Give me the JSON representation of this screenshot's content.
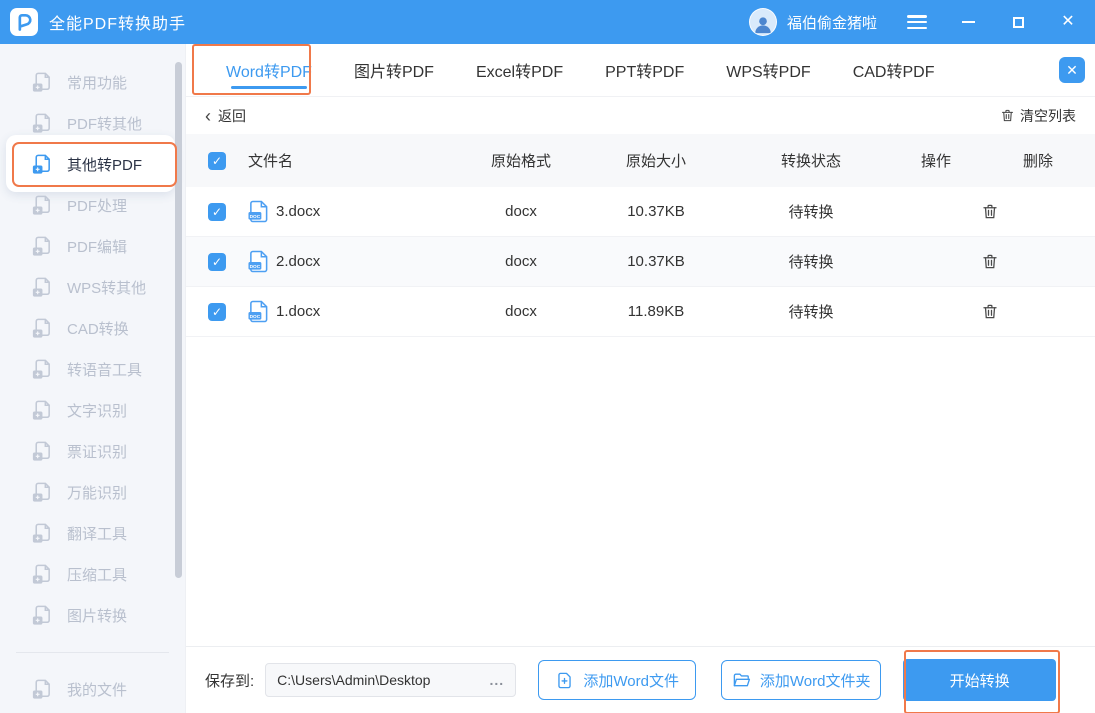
{
  "colors": {
    "accent": "#3D9AF0",
    "annotation_orange": "#F0794A",
    "topbar_blue": "#3D9AF0"
  },
  "titlebar": {
    "title": "全能PDF转换助手",
    "username": "福伯偷金猪啦",
    "controls": {
      "minimize": "─",
      "maximize": "□",
      "close": "✕"
    }
  },
  "sidebar": {
    "items": [
      {
        "label": "常用功能"
      },
      {
        "label": "PDF转其他"
      },
      {
        "label": "其他转PDF"
      },
      {
        "label": "PDF处理"
      },
      {
        "label": "PDF编辑"
      },
      {
        "label": "WPS转其他"
      },
      {
        "label": "CAD转换"
      },
      {
        "label": "转语音工具"
      },
      {
        "label": "文字识别"
      },
      {
        "label": "票证识别"
      },
      {
        "label": "万能识别"
      },
      {
        "label": "翻译工具"
      },
      {
        "label": "压缩工具"
      },
      {
        "label": "图片转换"
      },
      {
        "label": "我的文件"
      }
    ],
    "active_index": 2
  },
  "tabs": {
    "items": [
      {
        "label": "Word转PDF"
      },
      {
        "label": "图片转PDF"
      },
      {
        "label": "Excel转PDF"
      },
      {
        "label": "PPT转PDF"
      },
      {
        "label": "WPS转PDF"
      },
      {
        "label": "CAD转PDF"
      }
    ],
    "active_index": 0,
    "close": "✕"
  },
  "toolbar": {
    "back_chevron": "‹",
    "back": "返回",
    "clear": "清空列表"
  },
  "table": {
    "columns": [
      "文件名",
      "原始格式",
      "原始大小",
      "转换状态",
      "操作",
      "删除"
    ],
    "rows": [
      {
        "name": "3.docx",
        "format": "docx",
        "size": "10.37KB",
        "status": "待转换",
        "checked": true
      },
      {
        "name": "2.docx",
        "format": "docx",
        "size": "10.37KB",
        "status": "待转换",
        "checked": true
      },
      {
        "name": "1.docx",
        "format": "docx",
        "size": "11.89KB",
        "status": "待转换",
        "checked": true
      }
    ]
  },
  "footer": {
    "save_label": "保存到:",
    "path": "C:\\Users\\Admin\\Desktop",
    "browse": "...",
    "add_file": "添加Word文件",
    "add_folder": "添加Word文件夹",
    "start": "开始转换"
  }
}
